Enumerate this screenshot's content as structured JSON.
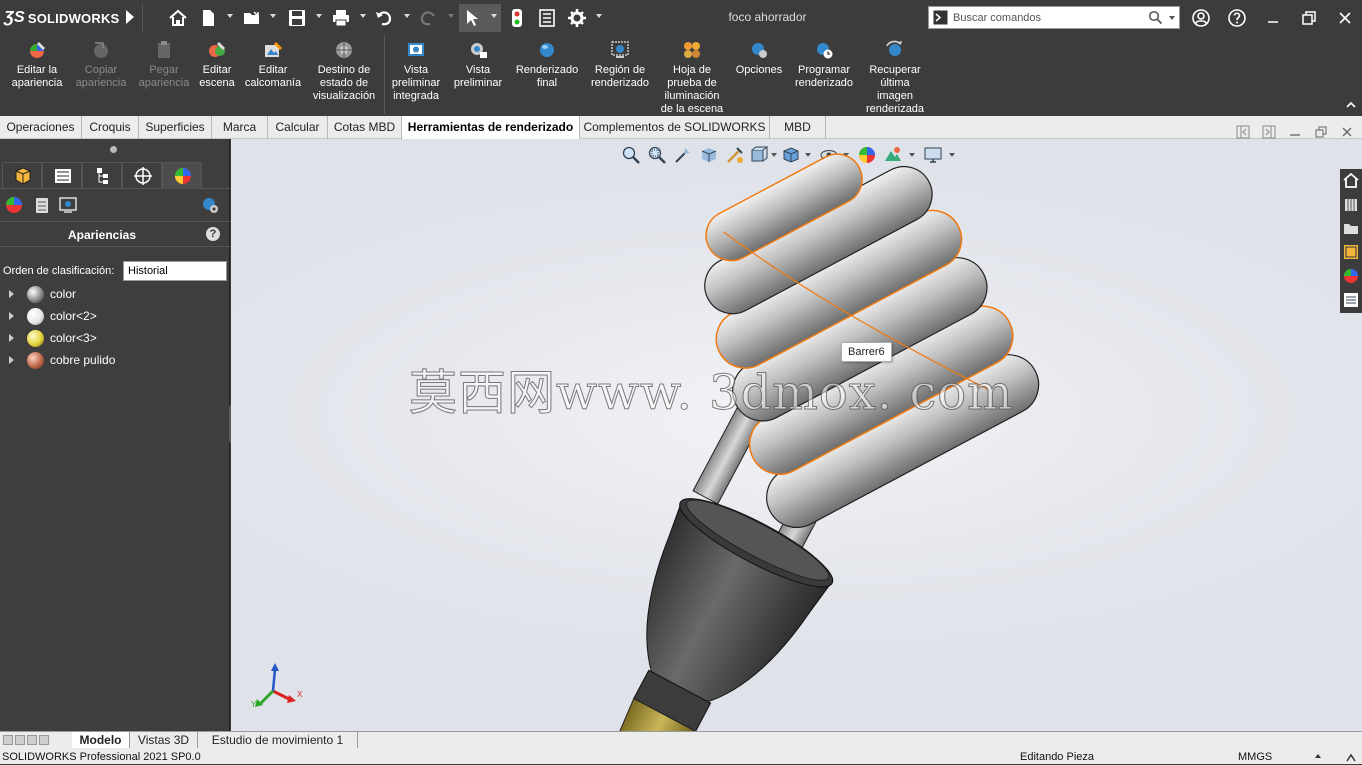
{
  "app": {
    "logo_text": "SOLIDWORKS",
    "document_title": "foco ahorrador"
  },
  "search": {
    "placeholder": "Buscar comandos"
  },
  "ribbon": {
    "buttons": [
      {
        "label": "Editar la\napariencia",
        "enabled": true
      },
      {
        "label": "Copiar\napariencia",
        "enabled": false
      },
      {
        "label": "Pegar\napariencia",
        "enabled": false
      },
      {
        "label": "Editar\nescena",
        "enabled": true
      },
      {
        "label": "Editar\ncalcomanía",
        "enabled": true
      },
      {
        "label": "Destino de\nestado de\nvisualización",
        "enabled": true
      },
      {
        "label": "Vista\npreliminar\nintegrada",
        "enabled": true
      },
      {
        "label": "Vista\npreliminar",
        "enabled": true
      },
      {
        "label": "Renderizado\nfinal",
        "enabled": true
      },
      {
        "label": "Región de\nrenderizado",
        "enabled": true
      },
      {
        "label": "Hoja de\nprueba de\niluminación\nde la escena",
        "enabled": true
      },
      {
        "label": "Opciones",
        "enabled": true
      },
      {
        "label": "Programar\nrenderizado",
        "enabled": true
      },
      {
        "label": "Recuperar\núltima\nimagen\nrenderizada",
        "enabled": true
      }
    ]
  },
  "tabs": [
    {
      "label": "Operaciones"
    },
    {
      "label": "Croquis"
    },
    {
      "label": "Superficies"
    },
    {
      "label": "Marca"
    },
    {
      "label": "Calcular"
    },
    {
      "label": "Cotas MBD"
    },
    {
      "label": "Herramientas de renderizado",
      "active": true
    },
    {
      "label": "Complementos de SOLIDWORKS"
    },
    {
      "label": "MBD"
    }
  ],
  "panel": {
    "title": "Apariencias",
    "help_symbol": "?",
    "sort_label": "Orden de clasificación:",
    "sort_value": "Historial",
    "items": [
      {
        "label": "color",
        "color": "#8a8a8a"
      },
      {
        "label": "color<2>",
        "color": "#e8e8e8"
      },
      {
        "label": "color<3>",
        "color": "#e3d23a"
      },
      {
        "label": "cobre pulido",
        "color": "#c0674a"
      }
    ]
  },
  "viewport": {
    "tooltip": "Barrer6",
    "watermark": "莫西网www. 3dmox. com",
    "triad": {
      "x": "X",
      "y": "Y"
    }
  },
  "bottom_tabs": [
    {
      "label": "Modelo",
      "active": true
    },
    {
      "label": "Vistas 3D"
    },
    {
      "label": "Estudio de movimiento 1"
    }
  ],
  "status": {
    "product": "SOLIDWORKS Professional 2021 SP0.0",
    "mode": "Editando Pieza",
    "units": "MMGS"
  },
  "colors": {
    "accent_orange": "#f07a10",
    "ui_dark": "#3c3c3c",
    "bulb_base": "#4a4a4a",
    "bulb_tip": "#b9a84a"
  }
}
